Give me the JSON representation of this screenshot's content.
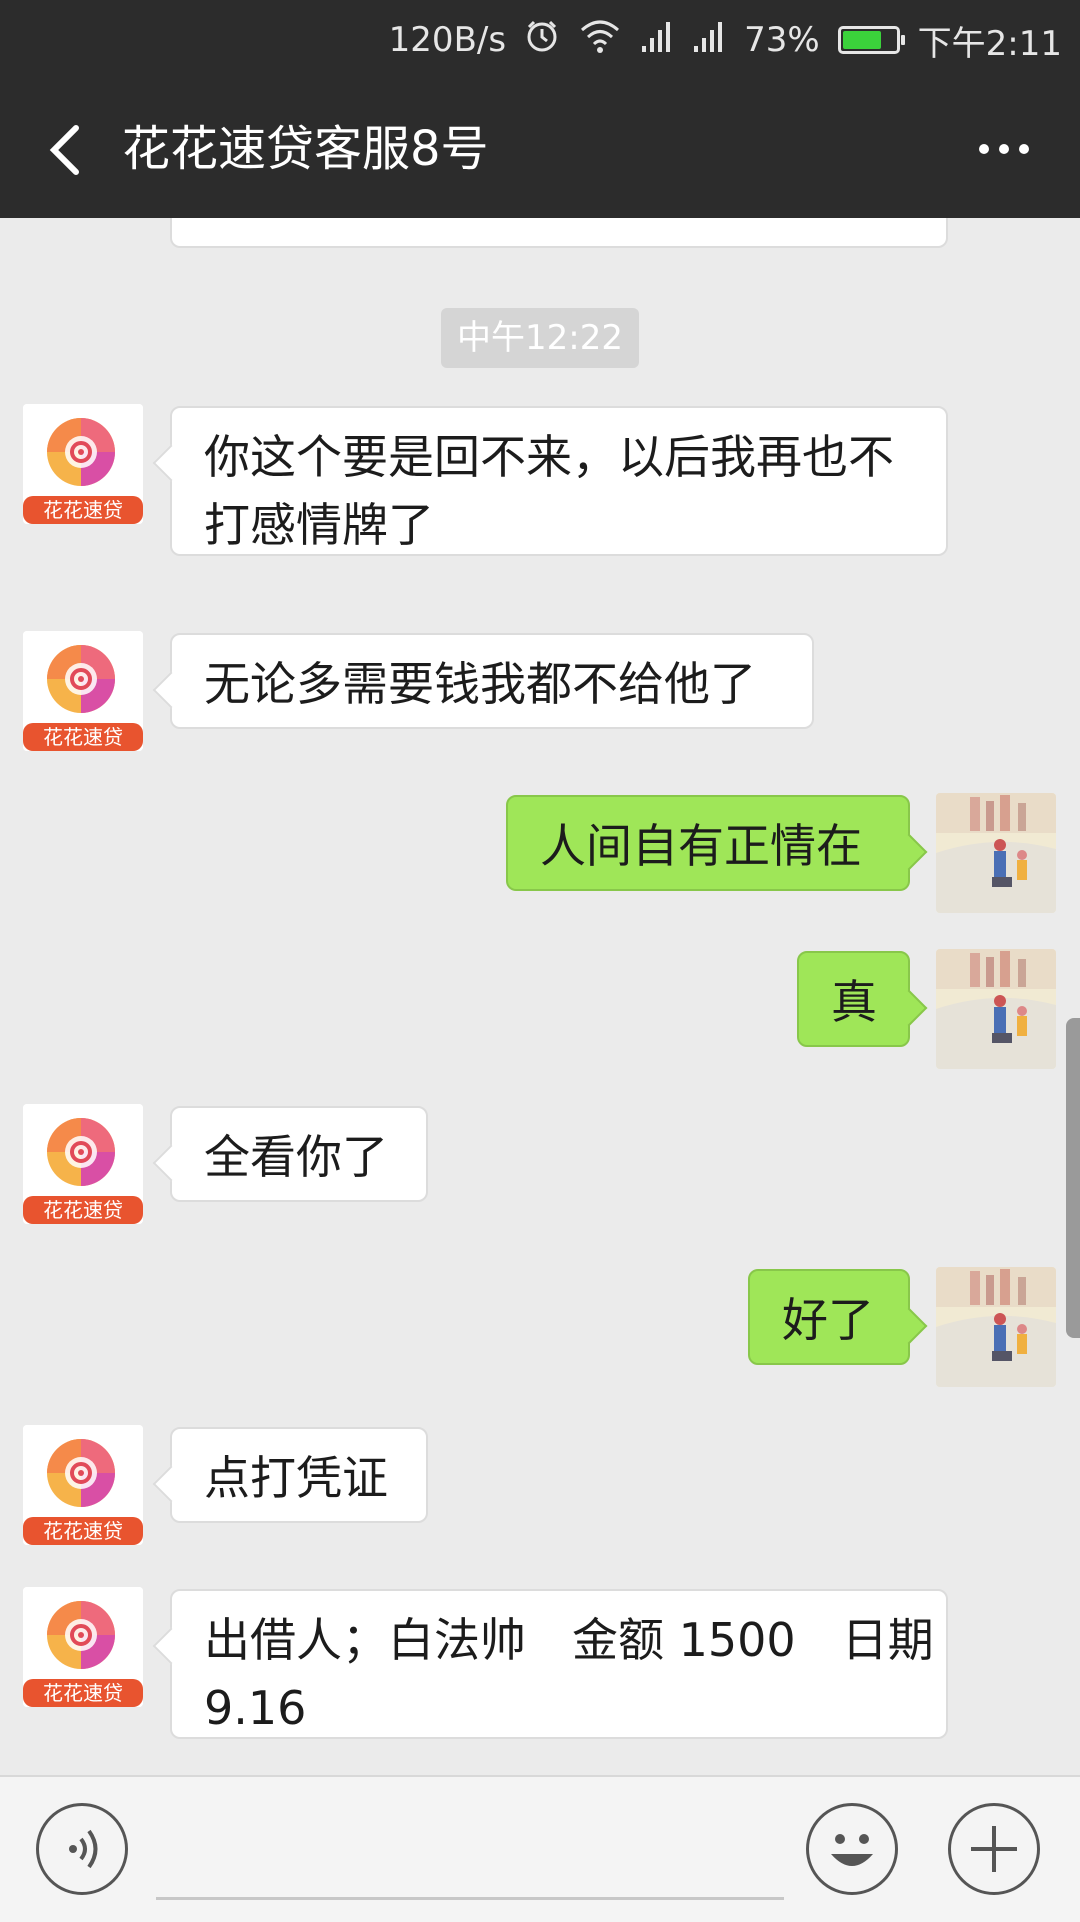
{
  "status_bar": {
    "speed": "120B/s",
    "battery": "73%",
    "battery_level": 0.73,
    "time": "下午2:11"
  },
  "header": {
    "title": "花花速贷客服8号",
    "back_icon": "chevron-left-icon",
    "more_icon": "more-dots-icon"
  },
  "chat": {
    "timestamp": "中午12:22",
    "messages": [
      {
        "from": "agent",
        "lines": [
          "你这个要是回不来，以后我再也不",
          "打感情牌了"
        ]
      },
      {
        "from": "agent",
        "lines": [
          "无论多需要钱我都不给他了"
        ]
      },
      {
        "from": "me",
        "lines": [
          "人间自有正情在"
        ]
      },
      {
        "from": "me",
        "lines": [
          "真"
        ]
      },
      {
        "from": "agent",
        "lines": [
          "全看你了"
        ]
      },
      {
        "from": "me",
        "lines": [
          "好了"
        ]
      },
      {
        "from": "agent",
        "lines": [
          "点打凭证"
        ]
      },
      {
        "from": "agent",
        "lines": [
          "出借人；白法帅　金额 1500　日期",
          "9.16"
        ]
      }
    ],
    "agent_avatar_label": "花花速贷"
  },
  "input_bar": {
    "voice_icon": "voice-icon",
    "emoji_icon": "emoji-icon",
    "plus_icon": "plus-icon",
    "text_value": ""
  },
  "colors": {
    "bar": "#2c2c2c",
    "chat_bg": "#ebebeb",
    "out_bubble": "#9fe658",
    "in_bubble": "#ffffff",
    "logo_ribbon": "#e8542f"
  }
}
